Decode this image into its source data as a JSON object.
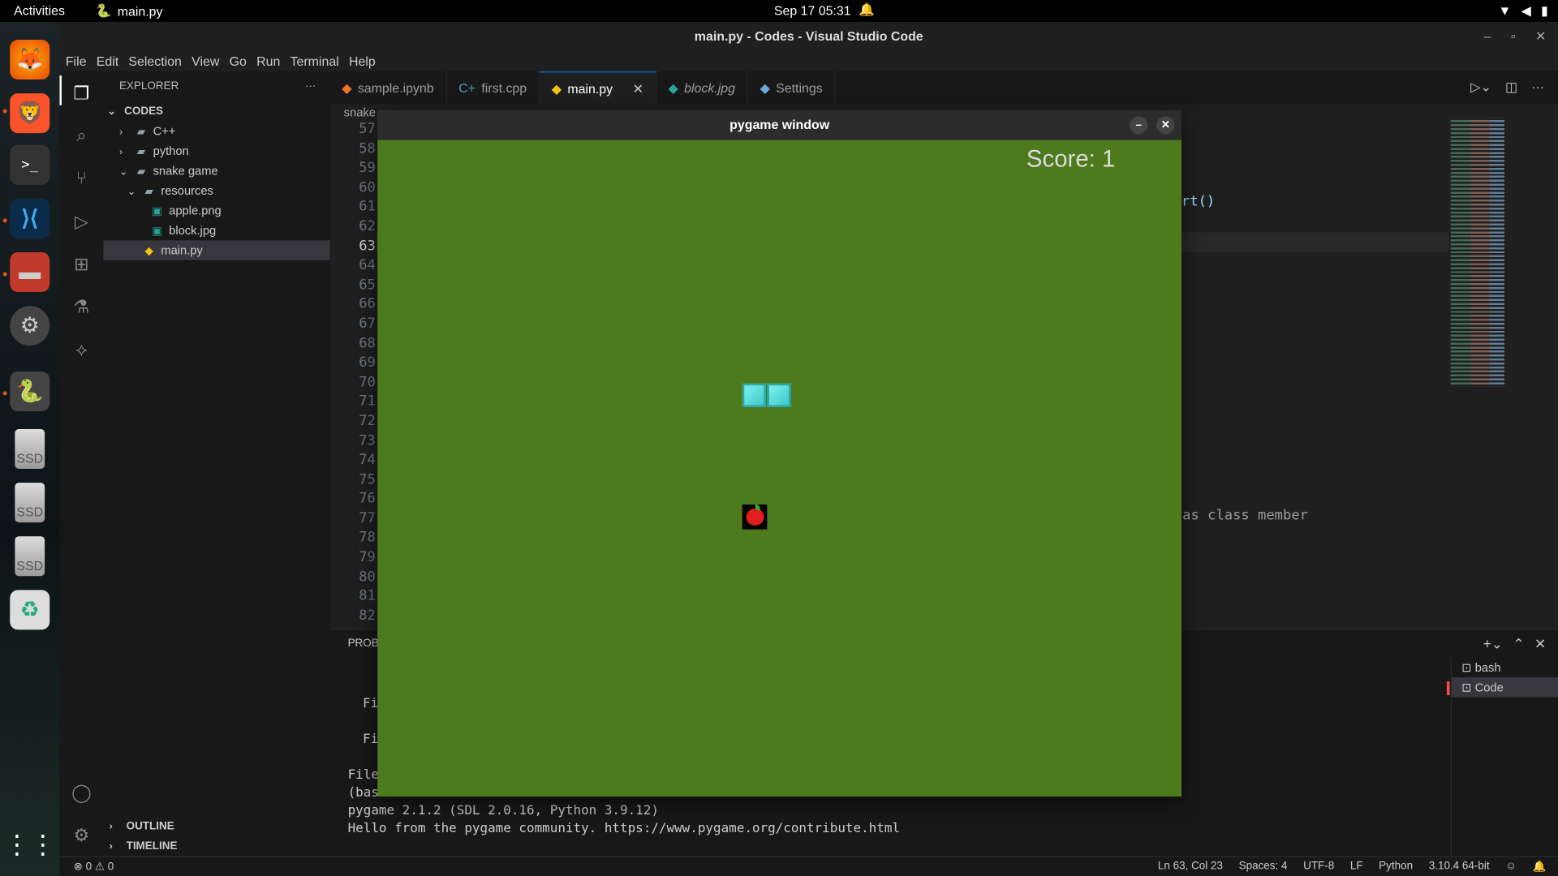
{
  "system": {
    "activities": "Activities",
    "app_name": "main.py",
    "clock": "Sep 17  05:31"
  },
  "vscode": {
    "window_title": "main.py - Codes - Visual Studio Code",
    "menu": [
      "File",
      "Edit",
      "Selection",
      "View",
      "Go",
      "Run",
      "Terminal",
      "Help"
    ],
    "explorer_title": "EXPLORER",
    "workspace": "CODES",
    "tree": [
      {
        "label": "C++",
        "depth": 0,
        "type": "folder",
        "expanded": false
      },
      {
        "label": "python",
        "depth": 0,
        "type": "folder",
        "expanded": false
      },
      {
        "label": "snake game",
        "depth": 0,
        "type": "folder",
        "expanded": true
      },
      {
        "label": "resources",
        "depth": 1,
        "type": "folder",
        "expanded": true
      },
      {
        "label": "apple.png",
        "depth": 2,
        "type": "image"
      },
      {
        "label": "block.jpg",
        "depth": 2,
        "type": "image"
      },
      {
        "label": "main.py",
        "depth": 1,
        "type": "python",
        "selected": true
      }
    ],
    "outline": "OUTLINE",
    "timeline": "TIMELINE",
    "tabs": [
      {
        "label": "sample.ipynb",
        "icon": "jupyter-icon"
      },
      {
        "label": "first.cpp",
        "icon": "cpp-icon"
      },
      {
        "label": "main.py",
        "icon": "python-icon",
        "active": true
      },
      {
        "label": "block.jpg",
        "icon": "image-icon"
      },
      {
        "label": "Settings",
        "icon": "settings-file-icon"
      }
    ],
    "breadcrumb": "snake",
    "line_numbers": [
      "57",
      "58",
      "59",
      "60",
      "61",
      "62",
      "63",
      "64",
      "65",
      "66",
      "67",
      "68",
      "69",
      "70",
      "71",
      "72",
      "73",
      "74",
      "75",
      "76",
      "77",
      "78",
      "79",
      "80",
      "81",
      "82"
    ],
    "current_line": "63",
    "code_fragments": {
      "line61": "rt()",
      "line77": "as class member"
    },
    "panel_tab": "PROBL",
    "terminal_lines": {
      "t1": "Fi",
      "t2": "Fi",
      "t3": "File",
      "t4": "(bas",
      "t5": "pygame 2.1.2 (SDL 2.0.16, Python 3.9.12)",
      "t6": "Hello from the pygame community. https://www.pygame.org/contribute.html"
    },
    "terminals": [
      {
        "label": "bash"
      },
      {
        "label": "Code",
        "selected": true
      }
    ],
    "status": {
      "errors": "0",
      "warnings": "0",
      "position": "Ln 63, Col 23",
      "spaces": "Spaces: 4",
      "encoding": "UTF-8",
      "eol": "LF",
      "language": "Python",
      "interpreter": "3.10.4 64-bit"
    }
  },
  "pygame": {
    "title": "pygame window",
    "score": "Score: 1"
  },
  "dock": {
    "ssd_label": "SSD"
  }
}
